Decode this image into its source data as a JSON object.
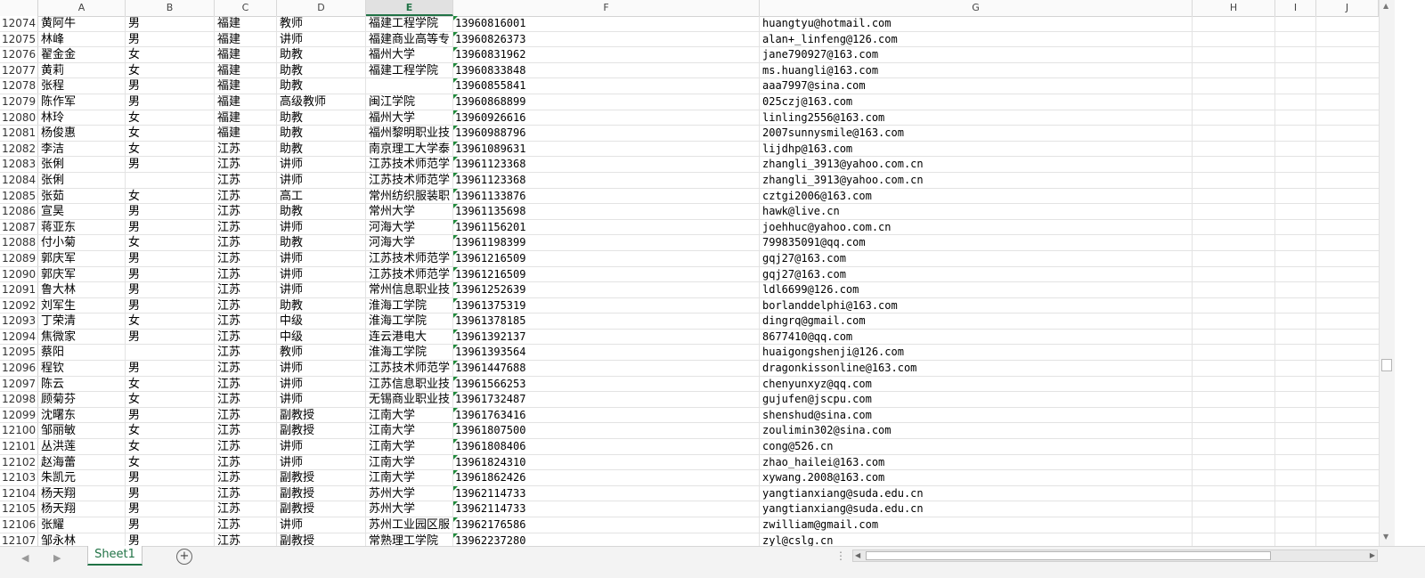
{
  "columns": [
    "A",
    "B",
    "C",
    "D",
    "E",
    "F",
    "G",
    "H",
    "I",
    "J"
  ],
  "selected_column": "E",
  "rows": [
    [
      "12074",
      "黄阿牛",
      "男",
      "福建",
      "教师",
      "福建工程学院",
      "13960816001",
      "huangtyu@hotmail.com"
    ],
    [
      "12075",
      "林峰",
      "男",
      "福建",
      "讲师",
      "福建商业高等专",
      "13960826373",
      "alan+_linfeng@126.com"
    ],
    [
      "12076",
      "翟金金",
      "女",
      "福建",
      "助教",
      "福州大学",
      "13960831962",
      "jane790927@163.com"
    ],
    [
      "12077",
      "黄莉",
      "女",
      "福建",
      "助教",
      "福建工程学院",
      "13960833848",
      "ms.huangli@163.com"
    ],
    [
      "12078",
      "张程",
      "男",
      "福建",
      "助教",
      "",
      "13960855841",
      "aaa7997@sina.com"
    ],
    [
      "12079",
      "陈作军",
      "男",
      "福建",
      "高级教师",
      "闽江学院",
      "13960868899",
      "025czj@163.com"
    ],
    [
      "12080",
      "林玲",
      "女",
      "福建",
      "助教",
      "福州大学",
      "13960926616",
      "linling2556@163.com"
    ],
    [
      "12081",
      "杨俊惠",
      "女",
      "福建",
      "助教",
      "福州黎明职业技",
      "13960988796",
      "2007sunnysmile@163.com"
    ],
    [
      "12082",
      "李洁",
      "女",
      "江苏",
      "助教",
      "南京理工大学泰",
      "13961089631",
      "lijdhp@163.com"
    ],
    [
      "12083",
      "张俐",
      "男",
      "江苏",
      "讲师",
      "江苏技术师范学",
      "13961123368",
      "zhangli_3913@yahoo.com.cn"
    ],
    [
      "12084",
      "张俐",
      "",
      "江苏",
      "讲师",
      "江苏技术师范学",
      "13961123368",
      "zhangli_3913@yahoo.com.cn"
    ],
    [
      "12085",
      "张茹",
      "女",
      "江苏",
      "高工",
      "常州纺织服装职",
      "13961133876",
      "cztgi2006@163.com"
    ],
    [
      "12086",
      "宣昊",
      "男",
      "江苏",
      "助教",
      "常州大学",
      "13961135698",
      "hawk@live.cn"
    ],
    [
      "12087",
      "蒋亚东",
      "男",
      "江苏",
      "讲师",
      "河海大学",
      "13961156201",
      "joehhuc@yahoo.com.cn"
    ],
    [
      "12088",
      "付小菊",
      "女",
      "江苏",
      "助教",
      "河海大学",
      "13961198399",
      "799835091@qq.com"
    ],
    [
      "12089",
      "郭庆军",
      "男",
      "江苏",
      "讲师",
      "江苏技术师范学",
      "13961216509",
      "gqj27@163.com"
    ],
    [
      "12090",
      "郭庆军",
      "男",
      "江苏",
      "讲师",
      "江苏技术师范学",
      "13961216509",
      "gqj27@163.com"
    ],
    [
      "12091",
      "鲁大林",
      "男",
      "江苏",
      "讲师",
      "常州信息职业技",
      "13961252639",
      "ldl6699@126.com"
    ],
    [
      "12092",
      "刘军生",
      "男",
      "江苏",
      "助教",
      "淮海工学院",
      "13961375319",
      "borlanddelphi@163.com"
    ],
    [
      "12093",
      "丁荣清",
      "女",
      "江苏",
      "中级",
      "淮海工学院",
      "13961378185",
      "dingrq@gmail.com"
    ],
    [
      "12094",
      "焦微家",
      "男",
      "江苏",
      "中级",
      "连云港电大",
      "13961392137",
      "8677410@qq.com"
    ],
    [
      "12095",
      "蔡阳",
      "",
      "江苏",
      "教师",
      "淮海工学院",
      "13961393564",
      "huaigongshenji@126.com"
    ],
    [
      "12096",
      "程钦",
      "男",
      "江苏",
      "讲师",
      "江苏技术师范学",
      "13961447688",
      "dragonkissonline@163.com"
    ],
    [
      "12097",
      "陈云",
      "女",
      "江苏",
      "讲师",
      "江苏信息职业技",
      "13961566253",
      "chenyunxyz@qq.com"
    ],
    [
      "12098",
      "顾菊芬",
      "女",
      "江苏",
      "讲师",
      "无锡商业职业技",
      "13961732487",
      "gujufen@jscpu.com"
    ],
    [
      "12099",
      "沈曙东",
      "男",
      "江苏",
      "副教授",
      "江南大学",
      "13961763416",
      "shenshud@sina.com"
    ],
    [
      "12100",
      "邹丽敏",
      "女",
      "江苏",
      "副教授",
      "江南大学",
      "13961807500",
      "zoulimin302@sina.com"
    ],
    [
      "12101",
      "丛洪莲",
      "女",
      "江苏",
      "讲师",
      "江南大学",
      "13961808406",
      "cong@526.cn"
    ],
    [
      "12102",
      "赵海蕾",
      "女",
      "江苏",
      "讲师",
      "江南大学",
      "13961824310",
      "zhao_hailei@163.com"
    ],
    [
      "12103",
      "朱凯元",
      "男",
      "江苏",
      "副教授",
      "江南大学",
      "13961862426",
      "xywang.2008@163.com"
    ],
    [
      "12104",
      "杨天翔",
      "男",
      "江苏",
      "副教授",
      "苏州大学",
      "13962114733",
      "yangtianxiang@suda.edu.cn"
    ],
    [
      "12105",
      "杨天翔",
      "男",
      "江苏",
      "副教授",
      "苏州大学",
      "13962114733",
      "yangtianxiang@suda.edu.cn"
    ],
    [
      "12106",
      "张耀",
      "男",
      "江苏",
      "讲师",
      "苏州工业园区服",
      "13962176586",
      "zwilliam@gmail.com"
    ],
    [
      "12107",
      "邹永林",
      "男",
      "江苏",
      "副教授",
      "常熟理工学院",
      "13962237280",
      "zyl@cslg.cn"
    ]
  ],
  "sheet_tab": "Sheet1",
  "add_sheet_label": "+",
  "nav_prev": "◀",
  "nav_next": "▶",
  "more_dots": "⋮",
  "scroll_up": "▲",
  "scroll_down": "▼",
  "scroll_left": "◀",
  "scroll_right": "▶",
  "accent_color": "#217346"
}
